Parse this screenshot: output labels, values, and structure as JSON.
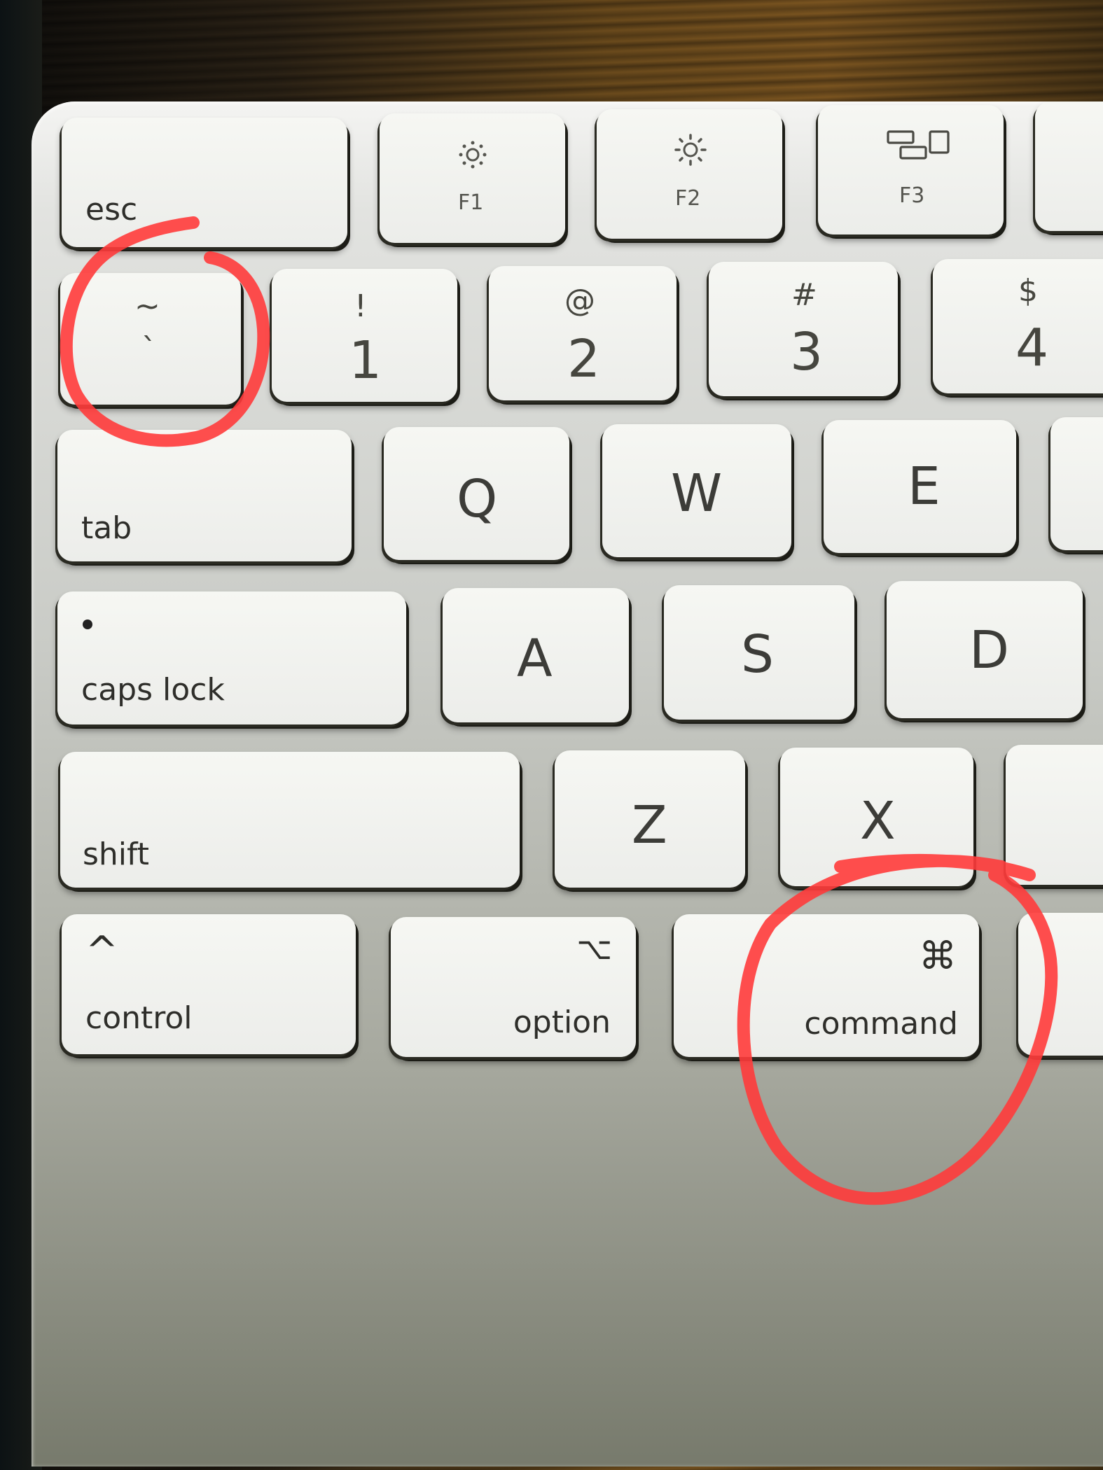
{
  "scene": {
    "description": "Close-up photo of an Apple Magic Keyboard (left section) on a wooden desk, with two keys circled in red marker",
    "annotation_color": "#ff3b3b",
    "annotated_keys": [
      "backtick-tilde",
      "command"
    ]
  },
  "keys": {
    "esc": {
      "label": "esc"
    },
    "f1": {
      "label": "F1",
      "icon": "brightness-down-icon"
    },
    "f2": {
      "label": "F2",
      "icon": "brightness-up-icon"
    },
    "f3": {
      "label": "F3",
      "icon": "mission-control-icon"
    },
    "tilde": {
      "shift": "~",
      "base": "`"
    },
    "one": {
      "shift": "!",
      "base": "1"
    },
    "two": {
      "shift": "@",
      "base": "2"
    },
    "three": {
      "shift": "#",
      "base": "3"
    },
    "four": {
      "shift": "$",
      "base": "4"
    },
    "tab": {
      "label": "tab"
    },
    "q": {
      "label": "Q"
    },
    "w": {
      "label": "W"
    },
    "e": {
      "label": "E"
    },
    "caps": {
      "label": "caps lock"
    },
    "a": {
      "label": "A"
    },
    "s": {
      "label": "S"
    },
    "d": {
      "label": "D"
    },
    "shift": {
      "label": "shift"
    },
    "z": {
      "label": "Z"
    },
    "x": {
      "label": "X"
    },
    "control": {
      "label": "control",
      "symbol": "^"
    },
    "option": {
      "label": "option",
      "symbol": "⌥"
    },
    "command": {
      "label": "command",
      "symbol": "⌘"
    }
  }
}
